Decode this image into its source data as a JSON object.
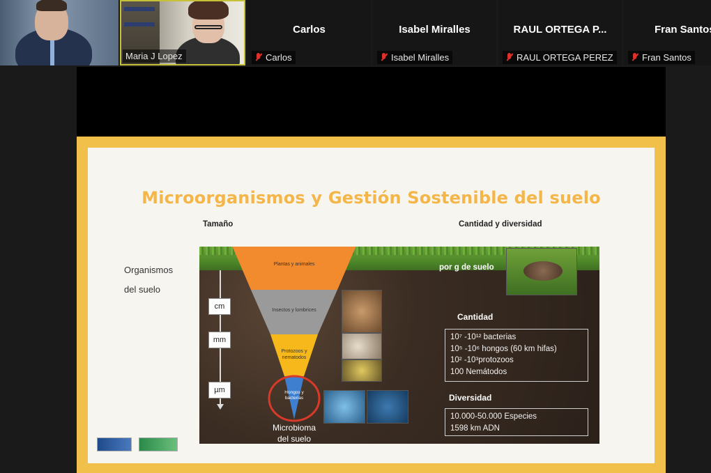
{
  "participants": [
    {
      "label": ""
    },
    {
      "label": "Maria J Lopez"
    },
    {
      "display_name": "Carlos",
      "label": "Carlos"
    },
    {
      "display_name": "Isabel Miralles",
      "label": "Isabel Miralles"
    },
    {
      "display_name": "RAUL ORTEGA P...",
      "label": "RAUL ORTEGA PEREZ"
    },
    {
      "display_name": "Fran Santos",
      "label": "Fran Santos"
    }
  ],
  "slide": {
    "title": "Microorganismos y Gestión Sostenible del suelo",
    "size_header": "Tamaño",
    "qty_header": "Cantidad y diversidad",
    "organisms_line1": "Organismos",
    "organisms_line2": "del suelo",
    "layers": [
      "Plantas y animales",
      "Insectos y lombrices",
      "Protozoos y nematodos",
      "Hongos y bacterias"
    ],
    "scale": [
      "cm",
      "mm",
      "µm"
    ],
    "microbioma_line1": "Microbioma",
    "microbioma_line2": "del suelo",
    "per_gram": "por g de suelo",
    "cantidad_title": "Cantidad",
    "cantidad_lines": [
      "10⁷ -10¹² bacterias",
      "10⁵ -10⁶ hongos (60 km hifas)",
      "10² -10³protozoos",
      "100 Nemátodos"
    ],
    "diversidad_title": "Diversidad",
    "diversidad_lines": [
      "10.000-50.000 Especies",
      "1598 km ADN"
    ]
  },
  "colors": {
    "slide_border": "#f0c04a",
    "title": "#f4b648",
    "layer_orange": "#f28a2e",
    "layer_gray": "#9a9a9a",
    "layer_yellow": "#f6b81a",
    "layer_blue": "#3f7fd0",
    "highlight_circle": "#d83a2a"
  }
}
